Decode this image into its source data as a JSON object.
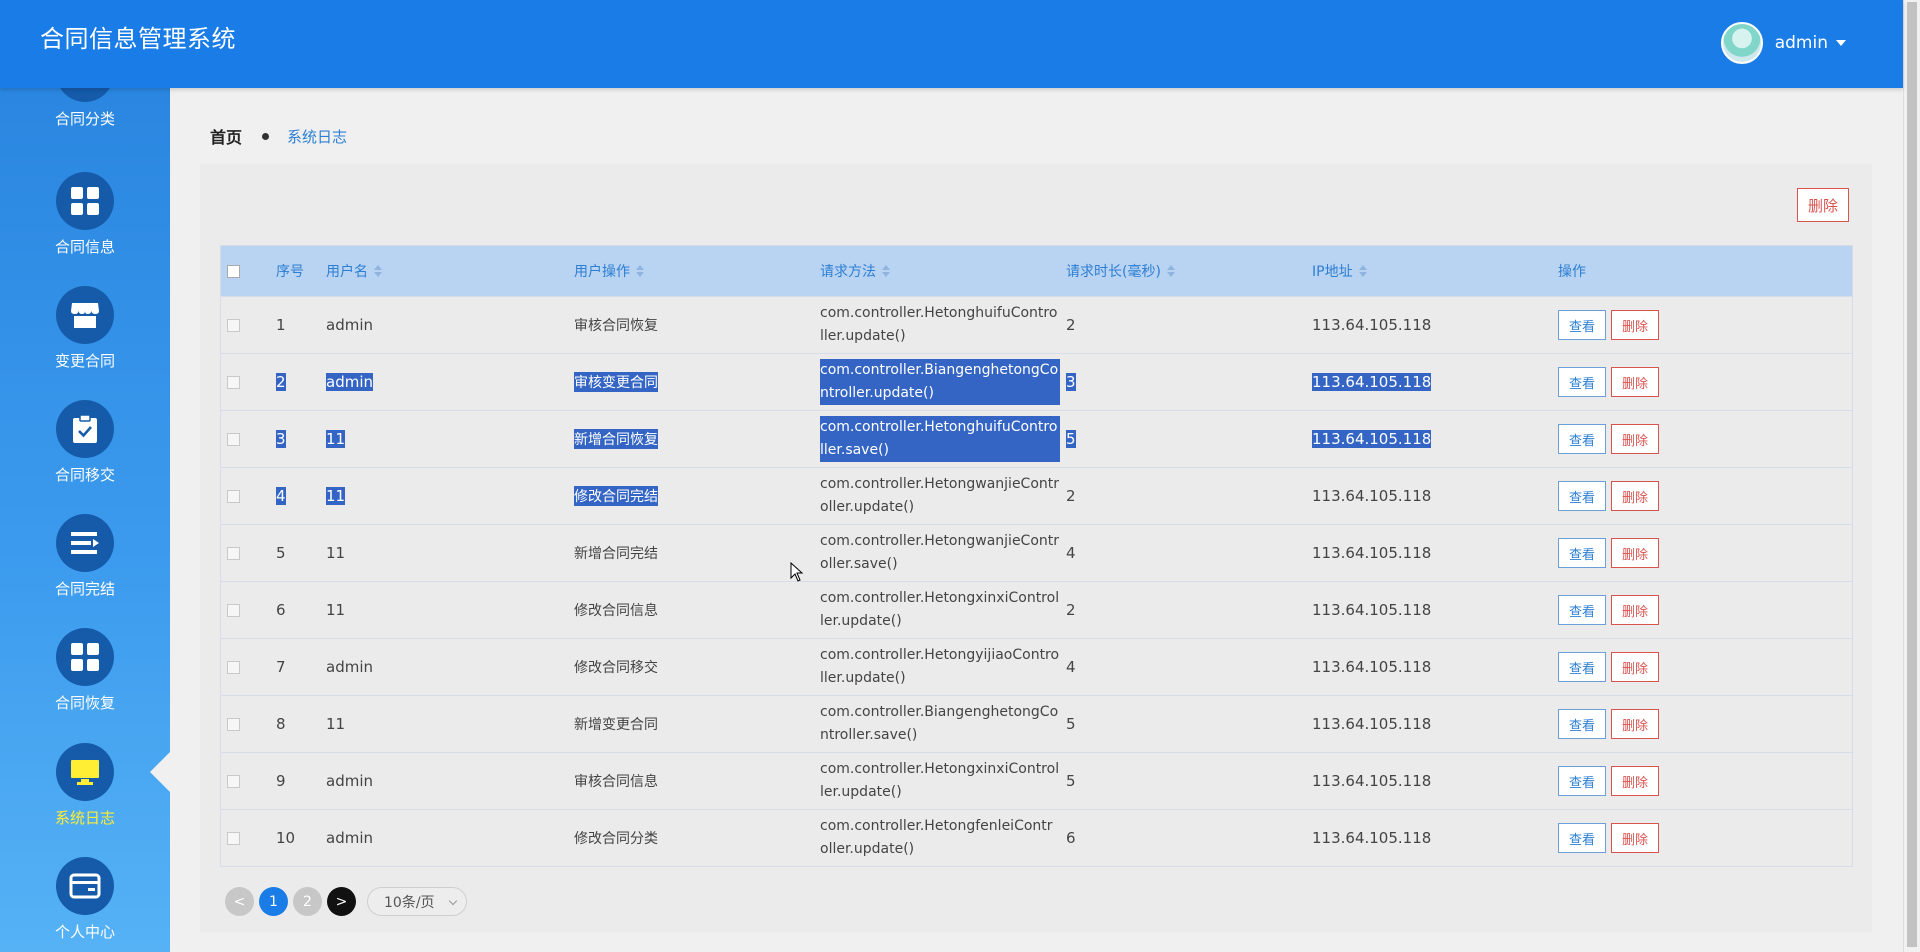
{
  "header": {
    "title": "合同信息管理系统",
    "username": "admin"
  },
  "sidebar": {
    "items": [
      {
        "label": "合同分类",
        "icon": "grid-icon"
      },
      {
        "label": "合同信息",
        "icon": "grid-icon"
      },
      {
        "label": "变更合同",
        "icon": "store-icon"
      },
      {
        "label": "合同移交",
        "icon": "clipboard-check-icon"
      },
      {
        "label": "合同完结",
        "icon": "list-icon"
      },
      {
        "label": "合同恢复",
        "icon": "grid-icon"
      },
      {
        "label": "系统日志",
        "icon": "monitor-icon",
        "active": true
      },
      {
        "label": "个人中心",
        "icon": "card-icon"
      }
    ]
  },
  "breadcrumb": {
    "home": "首页",
    "current": "系统日志"
  },
  "toolbar": {
    "delete_label": "删除"
  },
  "table": {
    "headers": {
      "index": "序号",
      "username": "用户名",
      "operation": "用户操作",
      "method": "请求方法",
      "duration": "请求时长(毫秒)",
      "ip": "IP地址",
      "actions": "操作"
    },
    "view_label": "查看",
    "delete_label": "删除",
    "rows": [
      {
        "index": "1",
        "username": "admin",
        "operation": "审核合同恢复",
        "method": "com.controller.HetonghuifuController.update()",
        "duration": "2",
        "ip": "113.64.105.118"
      },
      {
        "index": "2",
        "username": "admin",
        "operation": "审核变更合同",
        "method": "com.controller.BiangenghetongController.update()",
        "duration": "3",
        "ip": "113.64.105.118"
      },
      {
        "index": "3",
        "username": "11",
        "operation": "新增合同恢复",
        "method": "com.controller.HetonghuifuController.save()",
        "duration": "5",
        "ip": "113.64.105.118"
      },
      {
        "index": "4",
        "username": "11",
        "operation": "修改合同完结",
        "method": "com.controller.HetongwanjieController.update()",
        "duration": "2",
        "ip": "113.64.105.118"
      },
      {
        "index": "5",
        "username": "11",
        "operation": "新增合同完结",
        "method": "com.controller.HetongwanjieController.save()",
        "duration": "4",
        "ip": "113.64.105.118"
      },
      {
        "index": "6",
        "username": "11",
        "operation": "修改合同信息",
        "method": "com.controller.HetongxinxiController.update()",
        "duration": "2",
        "ip": "113.64.105.118"
      },
      {
        "index": "7",
        "username": "admin",
        "operation": "修改合同移交",
        "method": "com.controller.HetongyijiaoController.update()",
        "duration": "4",
        "ip": "113.64.105.118"
      },
      {
        "index": "8",
        "username": "11",
        "operation": "新增变更合同",
        "method": "com.controller.BiangenghetongController.save()",
        "duration": "5",
        "ip": "113.64.105.118"
      },
      {
        "index": "9",
        "username": "admin",
        "operation": "审核合同信息",
        "method": "com.controller.HetongxinxiController.update()",
        "duration": "5",
        "ip": "113.64.105.118"
      },
      {
        "index": "10",
        "username": "admin",
        "operation": "修改合同分类",
        "method": "com.controller.HetongfenleiController.update()",
        "duration": "6",
        "ip": "113.64.105.118"
      }
    ]
  },
  "pagination": {
    "prev": "<",
    "pages": [
      "1",
      "2"
    ],
    "current_page": "1",
    "next": ">",
    "page_size": "10条/页"
  }
}
